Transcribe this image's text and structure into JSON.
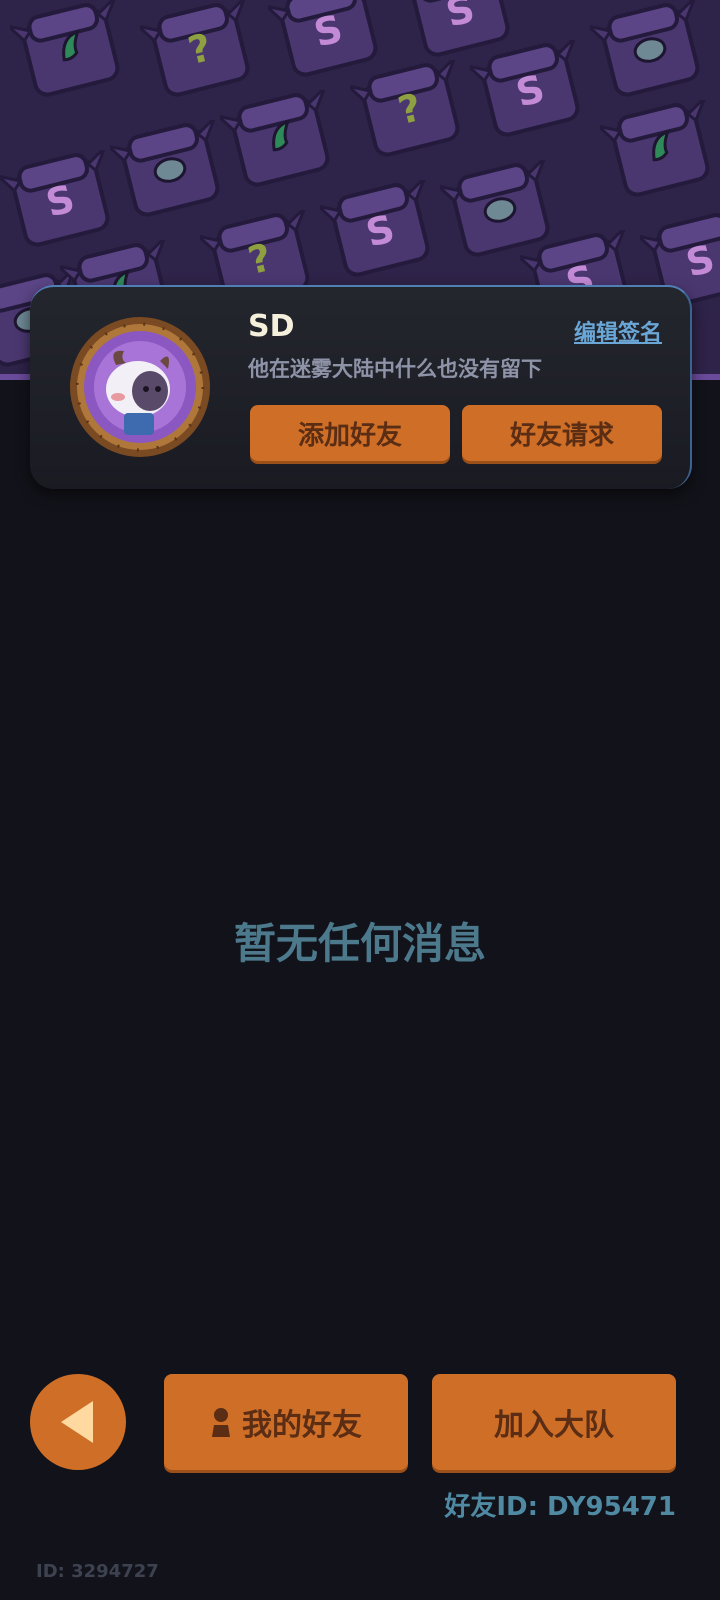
{
  "profile": {
    "username": "SD",
    "edit_signature_label": "编辑签名",
    "signature": "他在迷雾大陆中什么也没有留下",
    "add_friend_label": "添加好友",
    "friend_requests_label": "好友请求"
  },
  "messages": {
    "empty_text": "暂无任何消息"
  },
  "bottom": {
    "my_friends_label": "我的好友",
    "join_team_label": "加入大队",
    "friend_id": "好友ID: DY95471",
    "user_id": "ID: 3294727"
  },
  "pattern_glyphs": {
    "s": "S",
    "question": "?"
  },
  "colors": {
    "accent_orange": "#cf6f27",
    "button_text": "#5a2d14",
    "empty_text": "#4c7a8c",
    "link_blue": "#6aa6d6",
    "pattern_bg": "#2e2348"
  }
}
